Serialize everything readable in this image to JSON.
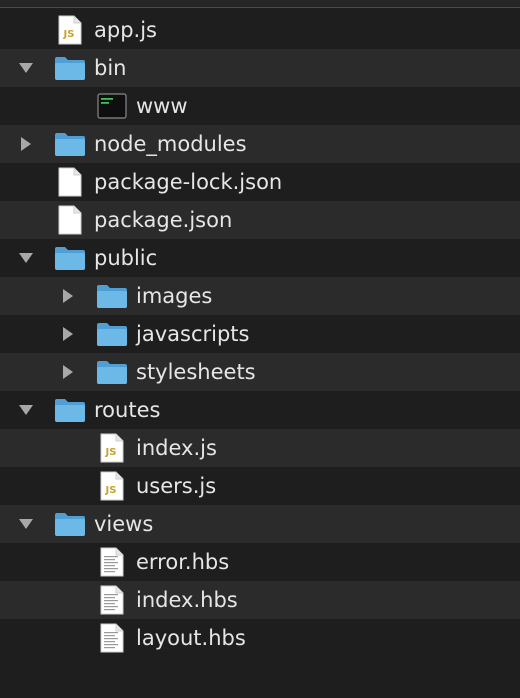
{
  "items": [
    {
      "name": "app.js",
      "kind": "js-file",
      "depth": 0,
      "disclosure": null,
      "icon": "js-file-icon"
    },
    {
      "name": "bin",
      "kind": "folder",
      "depth": 0,
      "disclosure": "expanded",
      "icon": "folder-icon"
    },
    {
      "name": "www",
      "kind": "executable",
      "depth": 1,
      "disclosure": null,
      "icon": "terminal-executable-icon"
    },
    {
      "name": "node_modules",
      "kind": "folder",
      "depth": 0,
      "disclosure": "collapsed",
      "icon": "folder-icon"
    },
    {
      "name": "package-lock.json",
      "kind": "blank-file",
      "depth": 0,
      "disclosure": null,
      "icon": "blank-document-icon"
    },
    {
      "name": "package.json",
      "kind": "blank-file",
      "depth": 0,
      "disclosure": null,
      "icon": "blank-document-icon"
    },
    {
      "name": "public",
      "kind": "folder",
      "depth": 0,
      "disclosure": "expanded",
      "icon": "folder-icon"
    },
    {
      "name": "images",
      "kind": "folder",
      "depth": 1,
      "disclosure": "collapsed",
      "icon": "folder-icon"
    },
    {
      "name": "javascripts",
      "kind": "folder",
      "depth": 1,
      "disclosure": "collapsed",
      "icon": "folder-icon"
    },
    {
      "name": "stylesheets",
      "kind": "folder",
      "depth": 1,
      "disclosure": "collapsed",
      "icon": "folder-icon"
    },
    {
      "name": "routes",
      "kind": "folder",
      "depth": 0,
      "disclosure": "expanded",
      "icon": "folder-icon"
    },
    {
      "name": "index.js",
      "kind": "js-file",
      "depth": 1,
      "disclosure": null,
      "icon": "js-file-icon"
    },
    {
      "name": "users.js",
      "kind": "js-file",
      "depth": 1,
      "disclosure": null,
      "icon": "js-file-icon"
    },
    {
      "name": "views",
      "kind": "folder",
      "depth": 0,
      "disclosure": "expanded",
      "icon": "folder-icon"
    },
    {
      "name": "error.hbs",
      "kind": "text-file",
      "depth": 1,
      "disclosure": null,
      "icon": "text-document-icon"
    },
    {
      "name": "index.hbs",
      "kind": "text-file",
      "depth": 1,
      "disclosure": null,
      "icon": "text-document-icon"
    },
    {
      "name": "layout.hbs",
      "kind": "text-file",
      "depth": 1,
      "disclosure": null,
      "icon": "text-document-icon"
    }
  ],
  "icon_labels": {
    "js-file": "JS",
    "executable": "exec"
  },
  "colors": {
    "background": "#1e1e1e",
    "row_alt": "#2b2b2b",
    "text": "#e6e6e6",
    "folder_front": "#6cb8e6",
    "folder_back": "#4f9fd4",
    "js_badge": "#c8a22a",
    "disclosure": "#a8a8a8"
  }
}
